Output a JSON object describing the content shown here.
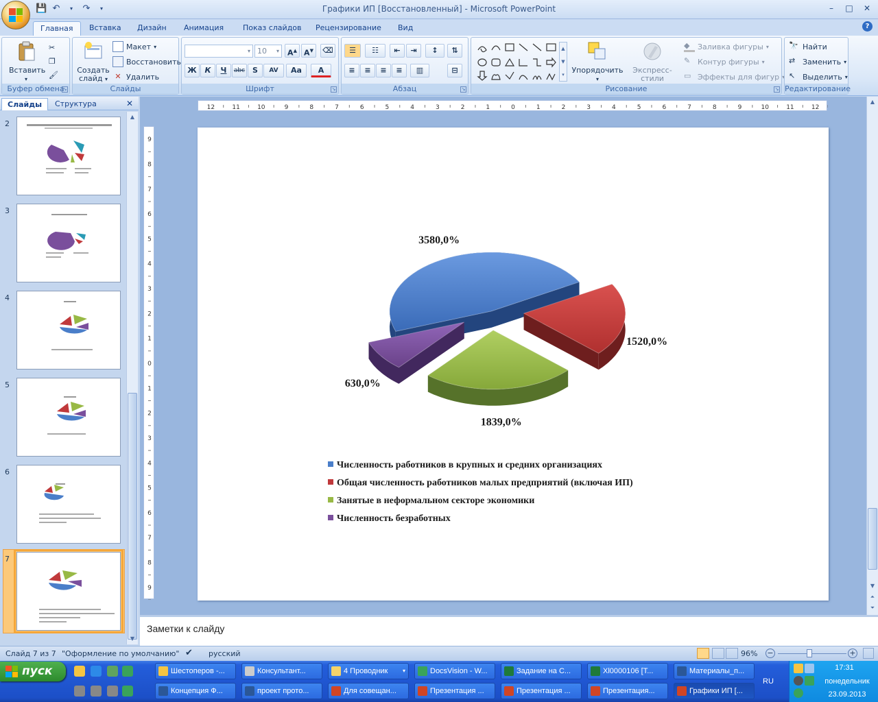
{
  "window": {
    "title": "Графики ИП [Восстановленный] - Microsoft PowerPoint",
    "controls": [
      "–",
      "□",
      "✕"
    ]
  },
  "tabs": [
    "Главная",
    "Вставка",
    "Дизайн",
    "Анимация",
    "Показ слайдов",
    "Рецензирование",
    "Вид"
  ],
  "ribbon": {
    "clipboard": {
      "paste": "Вставить",
      "label": "Буфер обмена"
    },
    "slides": {
      "new_slide_1": "Создать",
      "new_slide_2": "слайд",
      "layout": "Макет",
      "reset": "Восстановить",
      "delete": "Удалить",
      "label": "Слайды"
    },
    "font": {
      "size": "10",
      "label": "Шрифт",
      "bold": "Ж",
      "italic": "К",
      "underline": "Ч",
      "strike": "abc",
      "shadow": "S",
      "spacing": "AV",
      "case": "Aa",
      "color": "A"
    },
    "paragraph": {
      "label": "Абзац"
    },
    "drawing": {
      "arrange": "Упорядочить",
      "quick_styles": "Экспресс-стили",
      "fill": "Заливка фигуры",
      "outline": "Контур фигуры",
      "effects": "Эффекты для фигур",
      "label": "Рисование"
    },
    "editing": {
      "find": "Найти",
      "replace": "Заменить",
      "select": "Выделить",
      "label": "Редактирование"
    }
  },
  "left_pane": {
    "tabs": [
      "Слайды",
      "Структура"
    ],
    "slide_numbers": [
      "2",
      "3",
      "4",
      "5",
      "6",
      "7"
    ],
    "selected": "7"
  },
  "ruler": {
    "h_ticks": [
      "12",
      "11",
      "10",
      "9",
      "8",
      "7",
      "6",
      "5",
      "4",
      "3",
      "2",
      "1",
      "0",
      "1",
      "2",
      "3",
      "4",
      "5",
      "6",
      "7",
      "8",
      "9",
      "10",
      "11",
      "12"
    ],
    "v_ticks": [
      "9",
      "8",
      "7",
      "6",
      "5",
      "4",
      "3",
      "2",
      "1",
      "0",
      "1",
      "2",
      "3",
      "4",
      "5",
      "6",
      "7",
      "8",
      "9"
    ]
  },
  "chart_data": {
    "type": "pie",
    "categories": [
      "Численность работников в крупных и средних организациях",
      "Общая численность работников малых предприятий (включая ИП)",
      "Занятые в неформальном секторе экономики",
      "Численность безработных"
    ],
    "values": [
      3580,
      1520,
      1839,
      630
    ],
    "data_labels": [
      "3580,0%",
      "1520,0%",
      "1839,0%",
      "630,0%"
    ],
    "colors": [
      "#4a7ec9",
      "#c0393b",
      "#98b945",
      "#7a4f9c"
    ],
    "legend_position": "bottom",
    "exploded": true,
    "three_d": true
  },
  "notes": {
    "placeholder": "Заметки к слайду"
  },
  "statusbar": {
    "slide": "Слайд 7 из 7",
    "theme": "\"Оформление по умолчанию\"",
    "language": "русский",
    "zoom": "96%"
  },
  "taskbar": {
    "start": "пуск",
    "row1": [
      "Шестоперов -...",
      "Консультант...",
      "4 Проводник",
      "DocsVision - W...",
      "Задание на С...",
      "Xl0000106  [T...",
      "Материалы_п..."
    ],
    "row2": [
      "Концепция Ф...",
      "проект прото...",
      "Для совещан...",
      "Презентация ...",
      "Презентация ...",
      "Презентация...",
      "Графики ИП [..."
    ],
    "lang": "RU",
    "time": "17:31",
    "day": "понедельник",
    "date": "23.09.2013"
  }
}
